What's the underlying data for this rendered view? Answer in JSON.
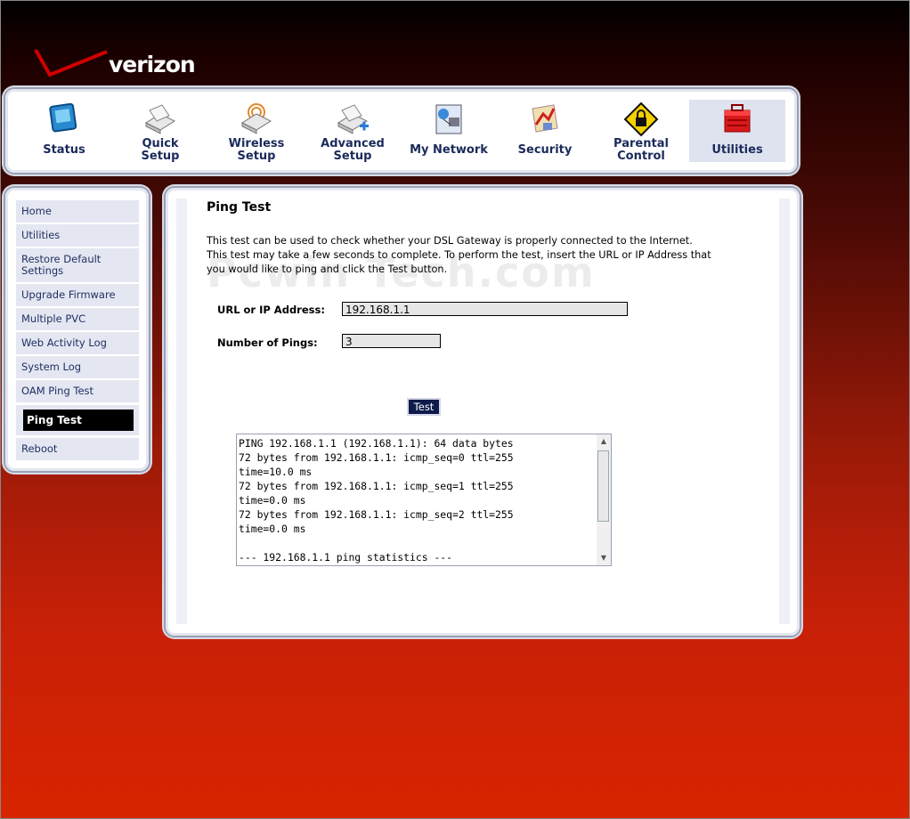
{
  "brand": {
    "logo_text": "verizon"
  },
  "nav": {
    "items": [
      {
        "id": "status",
        "label_lines": [
          "Status"
        ],
        "icon": "monitor-icon"
      },
      {
        "id": "quick-setup",
        "label_lines": [
          "Quick",
          "Setup"
        ],
        "icon": "scanner-icon"
      },
      {
        "id": "wireless-setup",
        "label_lines": [
          "Wireless",
          "Setup"
        ],
        "icon": "wireless-scanner-icon"
      },
      {
        "id": "advanced-setup",
        "label_lines": [
          "Advanced",
          "Setup"
        ],
        "icon": "advanced-scanner-icon"
      },
      {
        "id": "my-network",
        "label_lines": [
          "My Network"
        ],
        "icon": "network-icon"
      },
      {
        "id": "security",
        "label_lines": [
          "Security"
        ],
        "icon": "security-icon"
      },
      {
        "id": "parental-control",
        "label_lines": [
          "Parental",
          "Control"
        ],
        "icon": "padlock-warning-icon"
      },
      {
        "id": "utilities",
        "label_lines": [
          "Utilities"
        ],
        "icon": "toolbox-icon",
        "active": true
      }
    ]
  },
  "sidebar": {
    "items": [
      {
        "label": "Home"
      },
      {
        "label": "Utilities"
      },
      {
        "label": "Restore Default Settings"
      },
      {
        "label": "Upgrade Firmware"
      },
      {
        "label": "Multiple PVC"
      },
      {
        "label": "Web Activity Log"
      },
      {
        "label": "System Log"
      },
      {
        "label": "OAM Ping Test"
      },
      {
        "label": "Ping Test",
        "active": true
      },
      {
        "label": "Reboot"
      }
    ]
  },
  "main": {
    "title": "Ping Test",
    "description": "This test can be used to check whether your DSL Gateway is properly connected to the Internet. This test may take a few seconds to complete. To perform the test, insert the URL or IP Address that you would like to ping and click the Test button.",
    "watermark": "Pcwin Tech.com",
    "url_label": "URL or IP Address:",
    "url_value": "192.168.1.1",
    "pings_label": "Number of Pings:",
    "pings_value": "3",
    "test_button": "Test",
    "output_lines": [
      "PING 192.168.1.1 (192.168.1.1): 64 data bytes",
      "72 bytes from 192.168.1.1: icmp_seq=0 ttl=255",
      "time=10.0 ms",
      "72 bytes from 192.168.1.1: icmp_seq=1 ttl=255",
      "time=0.0 ms",
      "72 bytes from 192.168.1.1: icmp_seq=2 ttl=255",
      "time=0.0 ms",
      "",
      "--- 192.168.1.1 ping statistics ---"
    ]
  }
}
